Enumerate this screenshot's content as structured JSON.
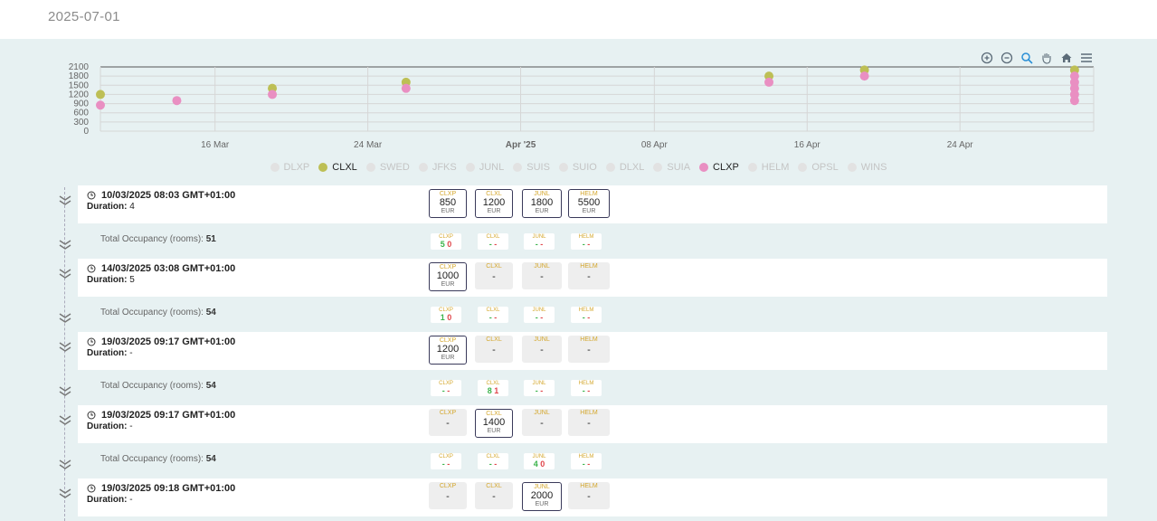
{
  "header": {
    "date": "2025-07-01"
  },
  "colors": {
    "clxl": "#bdbf55",
    "clxp": "#e98fc2",
    "faded": "#e2e2e2"
  },
  "chart_data": {
    "type": "scatter",
    "x_range": [
      "2025-03-10",
      "2025-05-01"
    ],
    "ylim": [
      0,
      2100
    ],
    "yticks": [
      0,
      300,
      600,
      900,
      1200,
      1500,
      1800,
      2100
    ],
    "xticks": [
      {
        "date": "2025-03-16",
        "label": "16 Mar"
      },
      {
        "date": "2025-03-24",
        "label": "24 Mar"
      },
      {
        "date": "2025-04-01",
        "label": "Apr '25"
      },
      {
        "date": "2025-04-08",
        "label": "08 Apr"
      },
      {
        "date": "2025-04-16",
        "label": "16 Apr"
      },
      {
        "date": "2025-04-24",
        "label": "24 Apr"
      }
    ],
    "legend": [
      {
        "name": "DLXP",
        "active": false
      },
      {
        "name": "CLXL",
        "active": true,
        "color": "#bdbf55"
      },
      {
        "name": "SWED",
        "active": false
      },
      {
        "name": "JFKS",
        "active": false
      },
      {
        "name": "JUNL",
        "active": false
      },
      {
        "name": "SUIS",
        "active": false
      },
      {
        "name": "SUIO",
        "active": false
      },
      {
        "name": "DLXL",
        "active": false
      },
      {
        "name": "SUIA",
        "active": false
      },
      {
        "name": "CLXP",
        "active": true,
        "color": "#e98fc2"
      },
      {
        "name": "HELM",
        "active": false
      },
      {
        "name": "OPSL",
        "active": false
      },
      {
        "name": "WINS",
        "active": false
      }
    ],
    "series": [
      {
        "name": "CLXL",
        "points": [
          [
            "2025-03-10",
            1200
          ],
          [
            "2025-03-19",
            1400
          ],
          [
            "2025-03-26",
            1600
          ],
          [
            "2025-04-14",
            1800
          ],
          [
            "2025-04-19",
            2000
          ],
          [
            "2025-04-30",
            2000
          ]
        ]
      },
      {
        "name": "CLXP",
        "points": [
          [
            "2025-03-10",
            850
          ],
          [
            "2025-03-14",
            1000
          ],
          [
            "2025-03-19",
            1200
          ],
          [
            "2025-03-26",
            1400
          ],
          [
            "2025-04-14",
            1600
          ],
          [
            "2025-04-19",
            1800
          ],
          [
            "2025-04-30",
            1800
          ],
          [
            "2025-04-30",
            1600
          ],
          [
            "2025-04-30",
            1400
          ],
          [
            "2025-04-30",
            1200
          ],
          [
            "2025-04-30",
            1000
          ]
        ]
      }
    ]
  },
  "events": [
    {
      "datetime": "10/03/2025 08:03 GMT+01:00",
      "duration_label": "Duration:",
      "duration": "4",
      "prices": [
        {
          "code": "CLXP",
          "value": "850",
          "cur": "EUR",
          "on": true
        },
        {
          "code": "CLXL",
          "value": "1200",
          "cur": "EUR",
          "on": true
        },
        {
          "code": "JUNL",
          "value": "1800",
          "cur": "EUR",
          "on": true
        },
        {
          "code": "HELM",
          "value": "5500",
          "cur": "EUR",
          "on": true
        }
      ],
      "occ_label": "Total Occupancy (rooms):",
      "occ_value": "51",
      "occ": [
        {
          "code": "CLXP",
          "a": "5",
          "b": "0"
        },
        {
          "code": "CLXL",
          "a": "-",
          "b": "-"
        },
        {
          "code": "JUNL",
          "a": "-",
          "b": "-"
        },
        {
          "code": "HELM",
          "a": "-",
          "b": "-"
        }
      ]
    },
    {
      "datetime": "14/03/2025 03:08 GMT+01:00",
      "duration_label": "Duration:",
      "duration": "5",
      "prices": [
        {
          "code": "CLXP",
          "value": "1000",
          "cur": "EUR",
          "on": true
        },
        {
          "code": "CLXL",
          "value": "-",
          "cur": "",
          "on": false
        },
        {
          "code": "JUNL",
          "value": "-",
          "cur": "",
          "on": false
        },
        {
          "code": "HELM",
          "value": "-",
          "cur": "",
          "on": false
        }
      ],
      "occ_label": "Total Occupancy (rooms):",
      "occ_value": "54",
      "occ": [
        {
          "code": "CLXP",
          "a": "1",
          "b": "0"
        },
        {
          "code": "CLXL",
          "a": "-",
          "b": "-"
        },
        {
          "code": "JUNL",
          "a": "-",
          "b": "-"
        },
        {
          "code": "HELM",
          "a": "-",
          "b": "-"
        }
      ]
    },
    {
      "datetime": "19/03/2025 09:17 GMT+01:00",
      "duration_label": "Duration:",
      "duration": "-",
      "prices": [
        {
          "code": "CLXP",
          "value": "1200",
          "cur": "EUR",
          "on": true
        },
        {
          "code": "CLXL",
          "value": "-",
          "cur": "",
          "on": false
        },
        {
          "code": "JUNL",
          "value": "-",
          "cur": "",
          "on": false
        },
        {
          "code": "HELM",
          "value": "-",
          "cur": "",
          "on": false
        }
      ],
      "occ_label": "Total Occupancy (rooms):",
      "occ_value": "54",
      "occ": [
        {
          "code": "CLXP",
          "a": "-",
          "b": "-"
        },
        {
          "code": "CLXL",
          "a": "8",
          "b": "1"
        },
        {
          "code": "JUNL",
          "a": "-",
          "b": "-"
        },
        {
          "code": "HELM",
          "a": "-",
          "b": "-"
        }
      ]
    },
    {
      "datetime": "19/03/2025 09:17 GMT+01:00",
      "duration_label": "Duration:",
      "duration": "-",
      "prices": [
        {
          "code": "CLXP",
          "value": "-",
          "cur": "",
          "on": false
        },
        {
          "code": "CLXL",
          "value": "1400",
          "cur": "EUR",
          "on": true
        },
        {
          "code": "JUNL",
          "value": "-",
          "cur": "",
          "on": false
        },
        {
          "code": "HELM",
          "value": "-",
          "cur": "",
          "on": false
        }
      ],
      "occ_label": "Total Occupancy (rooms):",
      "occ_value": "54",
      "occ": [
        {
          "code": "CLXP",
          "a": "-",
          "b": "-"
        },
        {
          "code": "CLXL",
          "a": "-",
          "b": "-"
        },
        {
          "code": "JUNL",
          "a": "4",
          "b": "0"
        },
        {
          "code": "HELM",
          "a": "-",
          "b": "-"
        }
      ]
    },
    {
      "datetime": "19/03/2025 09:18 GMT+01:00",
      "duration_label": "Duration:",
      "duration": "-",
      "prices": [
        {
          "code": "CLXP",
          "value": "-",
          "cur": "",
          "on": false
        },
        {
          "code": "CLXL",
          "value": "-",
          "cur": "",
          "on": false
        },
        {
          "code": "JUNL",
          "value": "2000",
          "cur": "EUR",
          "on": true
        },
        {
          "code": "HELM",
          "value": "-",
          "cur": "",
          "on": false
        }
      ],
      "occ_label": "",
      "occ_value": "",
      "occ": []
    }
  ]
}
